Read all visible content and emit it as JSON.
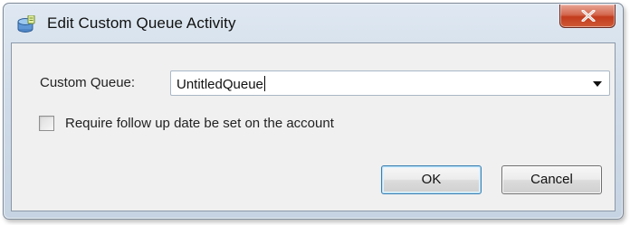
{
  "window": {
    "title": "Edit Custom Queue Activity",
    "close_symbol": "X"
  },
  "form": {
    "queue_label": "Custom Queue:",
    "queue_value": "UntitledQueue",
    "followup_label": "Require follow up date be set on the account",
    "followup_checked": false
  },
  "buttons": {
    "ok_label": "OK",
    "cancel_label": "Cancel"
  },
  "icons": {
    "app": "queue-database-icon",
    "close": "close-icon",
    "dropdown": "chevron-down-icon"
  },
  "colors": {
    "close_button": "#c23b1d",
    "title_bar": "#cfdbe8",
    "ok_focus_border": "#3c7fb1"
  }
}
